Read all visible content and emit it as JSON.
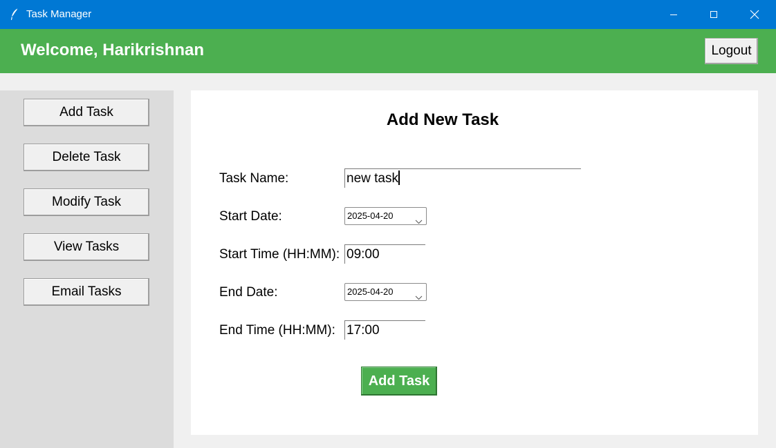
{
  "window": {
    "title": "Task Manager",
    "minimize_icon": "minimize-icon",
    "maximize_icon": "maximize-icon",
    "close_icon": "close-icon"
  },
  "header": {
    "welcome": "Welcome, Harikrishnan",
    "logout_label": "Logout",
    "background_color": "#4caf50"
  },
  "sidebar": {
    "items": [
      {
        "label": "Add Task"
      },
      {
        "label": "Delete Task"
      },
      {
        "label": "Modify Task"
      },
      {
        "label": "View Tasks"
      },
      {
        "label": "Email Tasks"
      }
    ]
  },
  "form": {
    "title": "Add New Task",
    "task_name": {
      "label": "Task Name:",
      "value": "new task"
    },
    "start_date": {
      "label": "Start Date:",
      "value": "2025-04-20"
    },
    "start_time": {
      "label": "Start Time (HH:MM):",
      "value": "09:00"
    },
    "end_date": {
      "label": "End Date:",
      "value": "2025-04-20"
    },
    "end_time": {
      "label": "End Time (HH:MM):",
      "value": "17:00"
    },
    "submit_label": "Add Task"
  },
  "colors": {
    "titlebar": "#0078d4",
    "accent": "#4caf50",
    "sidebar_bg": "#dcdcdc"
  }
}
